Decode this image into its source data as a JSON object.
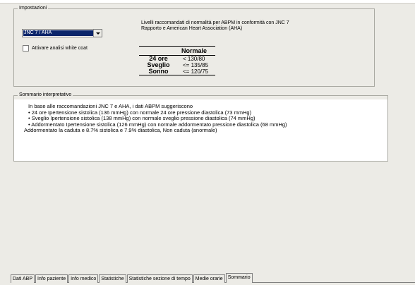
{
  "settings": {
    "legend": "Impostazioni",
    "standard_select": {
      "selected": "JNC 7 / AHA"
    },
    "white_coat_checkbox": {
      "label": "Attivare analisi white coat",
      "checked": false
    },
    "reference_info": [
      "Livelli raccomandati di normalità per ABPM in conformità con JNC 7",
      "Rapporto e American Heart Association (AHA)"
    ],
    "normal_table": {
      "header": "Normale",
      "rows": [
        {
          "label": "24 ore",
          "value": "< 130/80"
        },
        {
          "label": "Sveglio",
          "value": "<= 135/85"
        },
        {
          "label": "Sonno",
          "value": "<= 120/75"
        }
      ]
    }
  },
  "summary": {
    "legend": "Sommario interpretativo",
    "lines": [
      "In base alle raccomandazioni JNC 7 e AHA, i dati ABPM suggeriscono",
      "• 24 ore Ipertensione sistolica (136 mmHg) con normale 24 ore pressione diastolica (73 mmHg)",
      "• Sveglio Ipertensione sistolica (138 mmHg) con normale sveglio pressione diastolica (74 mmHg)",
      "• Addormentato Ipertensione sistolica (126 mmHg) con normale addormentato pressione diastolica (68 mmHg)",
      "Addormentato la caduta e 8.7% sistolica e 7.9% diastolica, Non caduta (anormale)"
    ]
  },
  "tabs": [
    {
      "label": "Dati ABP",
      "active": false
    },
    {
      "label": "Info paziente",
      "active": false
    },
    {
      "label": "Info medico",
      "active": false
    },
    {
      "label": "Statistiche",
      "active": false
    },
    {
      "label": "Statistiche sezione di tempo",
      "active": false
    },
    {
      "label": "Medie orarie",
      "active": false
    },
    {
      "label": "Sommario",
      "active": true
    }
  ]
}
